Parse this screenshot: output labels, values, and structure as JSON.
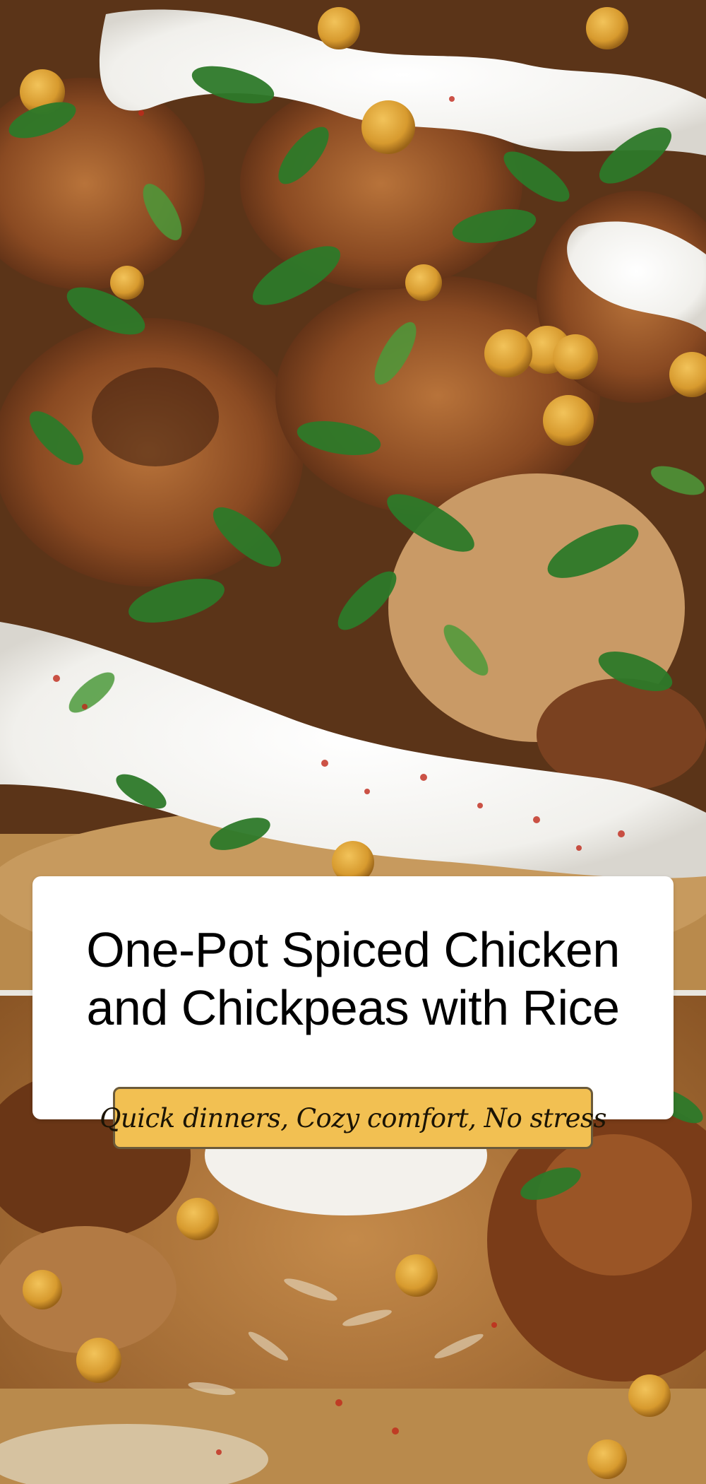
{
  "pin": {
    "title": "One-Pot Spiced Chicken and Chickpeas with Rice",
    "tagline": "Quick dinners, Cozy comfort, No stress"
  },
  "colors": {
    "card_background": "#ffffff",
    "title_text": "#000000",
    "tagline_background": "#f2c052",
    "tagline_border": "#6b5a3a",
    "tagline_text": "#1b1405"
  },
  "photo_top": {
    "subject": "yogurt-topped chicken and chickpeas with chopped parsley and paprika"
  },
  "photo_bottom": {
    "subject": "spiced rice with chicken, chickpeas and a dollop of yogurt in a pan"
  }
}
